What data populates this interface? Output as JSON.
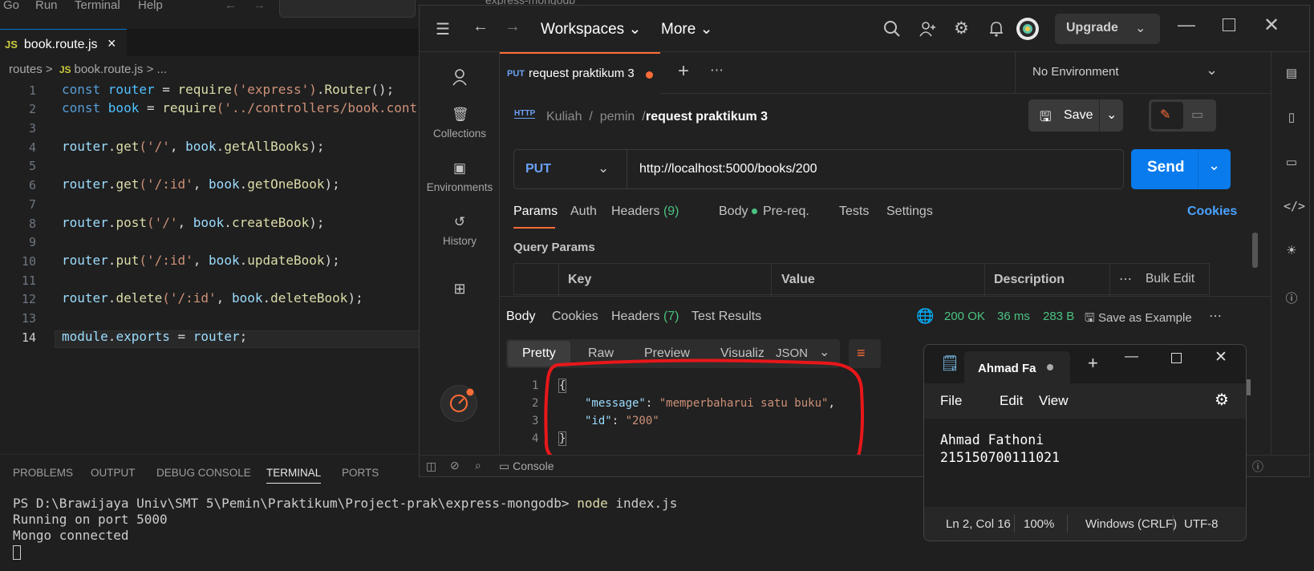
{
  "vscode": {
    "menu": [
      "Go",
      "Run",
      "Terminal",
      "Help"
    ],
    "search_fragment": "express-mongodb",
    "tab": {
      "badge": "JS",
      "label": "book.route.js",
      "close": "×"
    },
    "breadcrumb": {
      "folder": "routes",
      "sep": ">",
      "badge": "JS",
      "file": "book.route.js",
      "tail": "> ..."
    },
    "line_numbers": [
      "1",
      "2",
      "3",
      "4",
      "5",
      "6",
      "7",
      "8",
      "9",
      "10",
      "11",
      "12",
      "13",
      "14"
    ],
    "code": {
      "l1": {
        "a": "const ",
        "b": "router",
        "c": " = ",
        "d": "require",
        "e": "('express')",
        "f": ".",
        "g": "Router",
        "h": "();"
      },
      "l2": {
        "a": "const ",
        "b": "book",
        "c": " = ",
        "d": "require",
        "e": "('../controllers/book.contr"
      },
      "l4": {
        "a": "router",
        "b": ".",
        "c": "get",
        "d": "('/'",
        "e": ", ",
        "f": "book",
        "g": ".",
        "h": "getAllBooks",
        "i": ");"
      },
      "l6": {
        "a": "router",
        "b": ".",
        "c": "get",
        "d": "('/:id'",
        "e": ", ",
        "f": "book",
        "g": ".",
        "h": "getOneBook",
        "i": ");"
      },
      "l8": {
        "a": "router",
        "b": ".",
        "c": "post",
        "d": "('/'",
        "e": ", ",
        "f": "book",
        "g": ".",
        "h": "createBook",
        "i": ");"
      },
      "l10": {
        "a": "router",
        "b": ".",
        "c": "put",
        "d": "('/:id'",
        "e": ", ",
        "f": "book",
        "g": ".",
        "h": "updateBook",
        "i": ");"
      },
      "l12": {
        "a": "router",
        "b": ".",
        "c": "delete",
        "d": "('/:id'",
        "e": ", ",
        "f": "book",
        "g": ".",
        "h": "deleteBook",
        "i": ");"
      },
      "l14": {
        "a": "module",
        "b": ".",
        "c": "exports",
        "d": " = ",
        "e": "router",
        "f": ";"
      }
    },
    "panel_tabs": [
      "PROBLEMS",
      "OUTPUT",
      "DEBUG CONSOLE",
      "TERMINAL",
      "PORTS"
    ],
    "terminal": {
      "prompt": "PS D:\\Brawijaya Univ\\SMT 5\\Pemin\\Praktikum\\Project-prak\\express-mongodb> ",
      "cmd": "node",
      "arg": " index.js",
      "out1": "Running on port 5000",
      "out2": "Mongo connected"
    }
  },
  "postman": {
    "workspaces": "Workspaces",
    "more": "More",
    "upgrade": "Upgrade",
    "sidebar": [
      "Collections",
      "Environments",
      "History"
    ],
    "tab": {
      "method": "PUT",
      "name": "request praktikum 3"
    },
    "environment": "No Environment",
    "breadcrumb": {
      "p1": "Kuliah",
      "p2": "pemin",
      "current": "request praktikum 3",
      "http": "HTTP"
    },
    "save": "Save",
    "method": "PUT",
    "url": "http://localhost:5000/books/200",
    "send": "Send",
    "req_tabs": {
      "params": "Params",
      "auth": "Auth",
      "headers": "Headers",
      "headers_count": "(9)",
      "body": "Body",
      "prereq": "Pre-req.",
      "tests": "Tests",
      "settings": "Settings",
      "cookies": "Cookies"
    },
    "query_params": "Query Params",
    "table_headers": {
      "key": "Key",
      "value": "Value",
      "description": "Description",
      "bulk": "Bulk Edit"
    },
    "res_tabs": {
      "body": "Body",
      "cookies": "Cookies",
      "headers": "Headers",
      "headers_count": "(7)",
      "tests": "Test Results"
    },
    "status": {
      "code": "200 OK",
      "time": "36 ms",
      "size": "283 B",
      "save_example": "Save as Example"
    },
    "views": [
      "Pretty",
      "Raw",
      "Preview",
      "Visualize"
    ],
    "format": "JSON",
    "res_line_numbers": [
      "1",
      "2",
      "3",
      "4"
    ],
    "response": {
      "open": "{",
      "k1": "\"message\"",
      "v1": "\"memperbaharui satu buku\"",
      "k2": "\"id\"",
      "v2": "\"200\"",
      "close": "}"
    },
    "console": "Console"
  },
  "notepad": {
    "tab": "Ahmad Fa",
    "menu": [
      "File",
      "Edit",
      "View"
    ],
    "text": "Ahmad Fathoni\n215150700111021",
    "status": {
      "pos": "Ln 2, Col 16",
      "zoom": "100%",
      "eol": "Windows (CRLF)",
      "enc": "UTF-8"
    }
  },
  "colors": {
    "send": "#097bed",
    "annotation": "#e8171a",
    "accent": "#ff6c37"
  }
}
